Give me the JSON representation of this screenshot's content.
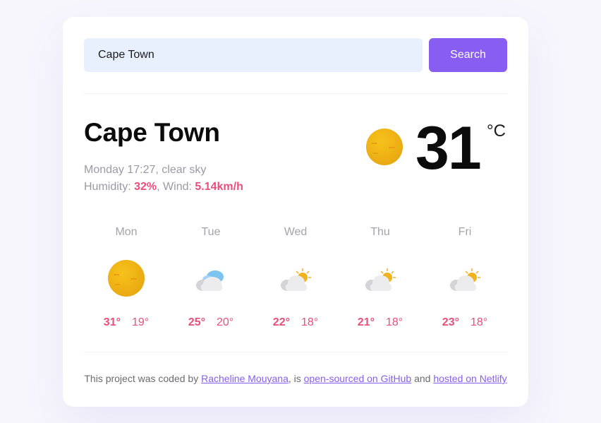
{
  "search": {
    "value": "Cape Town",
    "button_label": "Search"
  },
  "current": {
    "city": "Cape Town",
    "datetime": "Monday 17:27",
    "description": "clear sky",
    "humidity_label": "Humidity: ",
    "humidity": "32%",
    "wind_label": "Wind: ",
    "wind": "5.14km/h",
    "temperature": "31",
    "unit": "°C",
    "icon": "sun-icon"
  },
  "forecast": [
    {
      "day": "Mon",
      "max": "31°",
      "min": "19°",
      "icon": "sun-icon"
    },
    {
      "day": "Tue",
      "max": "25°",
      "min": "20°",
      "icon": "clouds-icon"
    },
    {
      "day": "Wed",
      "max": "22°",
      "min": "18°",
      "icon": "partly-cloudy-icon"
    },
    {
      "day": "Thu",
      "max": "21°",
      "min": "18°",
      "icon": "partly-cloudy-icon"
    },
    {
      "day": "Fri",
      "max": "23°",
      "min": "18°",
      "icon": "partly-cloudy-icon"
    }
  ],
  "footer": {
    "prefix": "This project was coded by ",
    "author_link": "Racheline Mouyana",
    "middle1": ", is ",
    "github_link": "open-sourced on GitHub",
    "middle2": " and ",
    "netlify_link": "hosted on Netlify"
  },
  "colors": {
    "accent": "#885df1",
    "highlight": "#ea4e7a",
    "input_bg": "#e8f0fd"
  }
}
